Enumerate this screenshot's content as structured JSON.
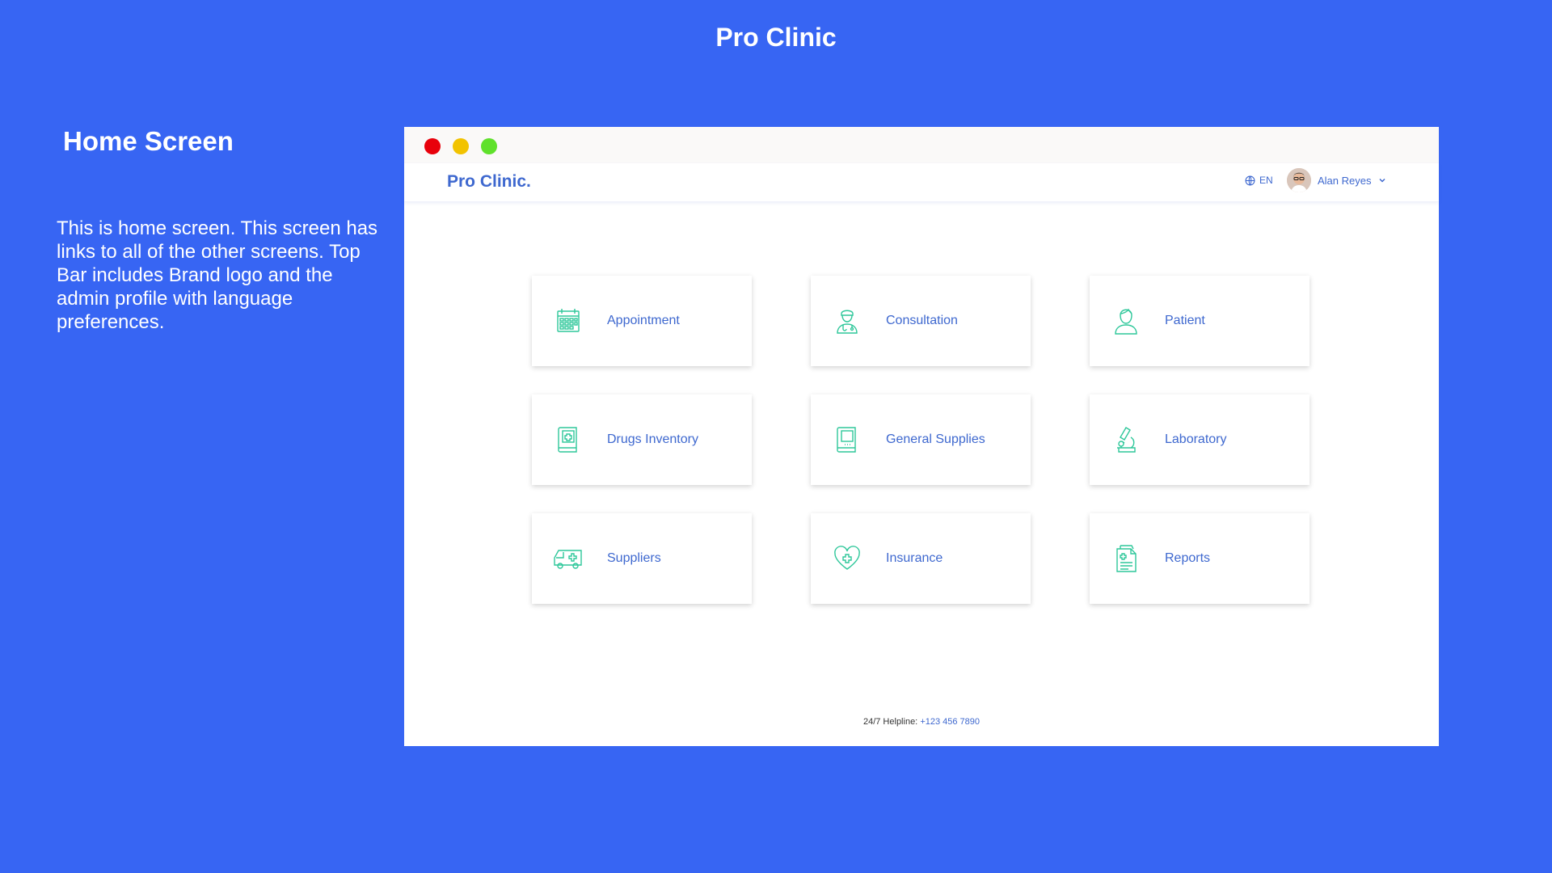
{
  "page": {
    "title": "Pro Clinic",
    "heading": "Home Screen",
    "description": "This is home screen. This screen has links to all of the other screens. Top Bar includes Brand logo and the admin profile with language preferences."
  },
  "window": {
    "controls": [
      "close-dot",
      "minimize-dot",
      "maximize-dot"
    ]
  },
  "appbar": {
    "brand": "Pro Clinic.",
    "language": "EN",
    "user_name": "Alan Reyes"
  },
  "modules": [
    {
      "label": "Appointment",
      "icon": "calendar-icon"
    },
    {
      "label": "Consultation",
      "icon": "doctor-icon"
    },
    {
      "label": "Patient",
      "icon": "patient-icon"
    },
    {
      "label": "Drugs Inventory",
      "icon": "medicine-book-icon"
    },
    {
      "label": "General Supplies",
      "icon": "supplies-icon"
    },
    {
      "label": "Laboratory",
      "icon": "microscope-icon"
    },
    {
      "label": "Suppliers",
      "icon": "ambulance-icon"
    },
    {
      "label": "Insurance",
      "icon": "heart-cross-icon"
    },
    {
      "label": "Reports",
      "icon": "report-icon"
    }
  ],
  "footer": {
    "label": "24/7 Helpline:",
    "phone": "+123 456 7890"
  },
  "colors": {
    "background": "#3765f3",
    "accent": "#3e68cf",
    "icon": "#2ec79a"
  }
}
